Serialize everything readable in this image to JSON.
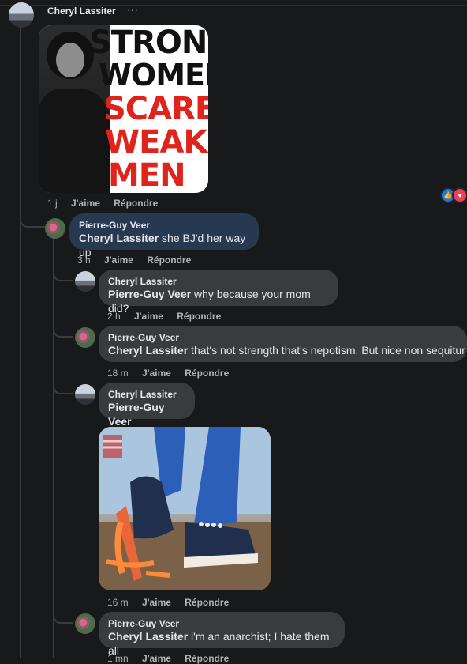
{
  "top_comment": {
    "author": "Cheryl Lassiter",
    "more": "···",
    "image_text": [
      "STRONG",
      "WOMEN",
      "SCARE",
      "WEAK",
      "MEN"
    ],
    "time": "1 j",
    "like": "J'aime",
    "reply": "Répondre"
  },
  "replies": [
    {
      "author": "Pierre-Guy Veer",
      "mention": "Cheryl Lassiter",
      "text": " she BJ'd her way up",
      "time": "3 h",
      "like": "J'aime",
      "reply": "Répondre"
    },
    {
      "author": "Cheryl Lassiter",
      "mention": "Pierre-Guy Veer",
      "text": " why because your mom did?",
      "time": "2 h",
      "like": "J'aime",
      "reply": "Répondre"
    },
    {
      "author": "Pierre-Guy Veer",
      "mention": "Cheryl Lassiter",
      "text": " that's not strength that's nepotism. But nice non sequitur",
      "time": "18 m",
      "like": "J'aime",
      "reply": "Répondre"
    },
    {
      "author": "Cheryl Lassiter",
      "mention": "Pierre-Guy Veer",
      "text": "",
      "time": "16 m",
      "like": "J'aime",
      "reply": "Répondre"
    },
    {
      "author": "Pierre-Guy Veer",
      "mention": "Cheryl Lassiter",
      "text": " i'm an anarchist; I hate them all",
      "time": "1 mn",
      "like": "J'aime",
      "reply": "Répondre"
    }
  ],
  "colors": {
    "background": "#18191a",
    "bubble": "#3a3b3c",
    "highlight": "#263951",
    "like_blue": "#1877f2",
    "love_red": "#f33e58",
    "poster_red": "#e0241b"
  }
}
